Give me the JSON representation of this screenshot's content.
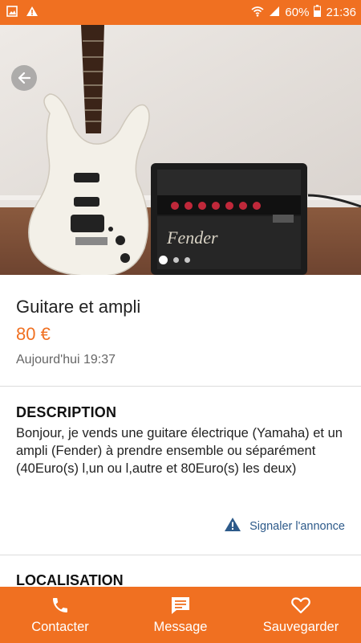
{
  "status_bar": {
    "battery": "60%",
    "time": "21:36",
    "icons": [
      "image-notification-icon",
      "warning-notification-icon",
      "wifi-icon",
      "signal-icon",
      "battery-icon"
    ]
  },
  "listing": {
    "title": "Guitare et ampli",
    "price": "80 €",
    "date": "Aujourd'hui 19:37"
  },
  "gallery": {
    "total": 3,
    "current": 1
  },
  "description": {
    "heading": "DESCRIPTION",
    "text": "Bonjour, je vends une guitare électrique  (Yamaha) et un ampli (Fender) à prendre ensemble ou séparément (40Euro(s) l,un ou l,autre et 80Euro(s) les deux)"
  },
  "report_label": "Signaler l'annonce",
  "location_heading": "LOCALISATION",
  "actions": {
    "contact": "Contacter",
    "message": "Message",
    "save": "Sauvegarder"
  },
  "colors": {
    "accent": "#f07021",
    "link": "#2d5a8a"
  }
}
